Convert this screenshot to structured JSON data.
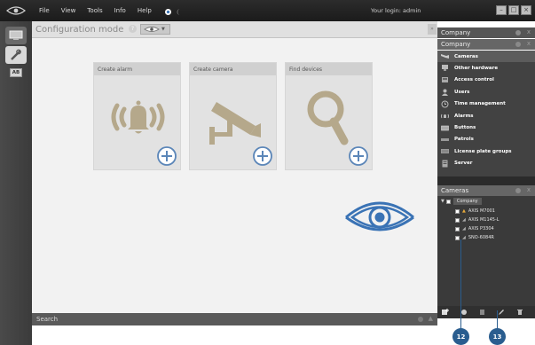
{
  "menubar": {
    "items": [
      "File",
      "View",
      "Tools",
      "Info",
      "Help"
    ],
    "login_text": "Your login: admin"
  },
  "left_rail": {
    "badge": "AB"
  },
  "main": {
    "title": "Configuration mode",
    "cards": [
      {
        "title": "Create alarm",
        "icon": "alarm-bell-icon"
      },
      {
        "title": "Create camera",
        "icon": "camera-icon"
      },
      {
        "title": "Find devices",
        "icon": "magnifier-icon"
      }
    ],
    "search_label": "Search"
  },
  "company_panel": {
    "title_1": "Company",
    "title_2": "Company",
    "items": [
      "Cameras",
      "Other hardware",
      "Access control",
      "Users",
      "Time management",
      "Alarms",
      "Buttons",
      "Patrols",
      "License plate groups",
      "Server"
    ],
    "active_index": 0
  },
  "cameras_panel": {
    "title": "Cameras",
    "root": "Company",
    "cameras": [
      "AXIS M7001",
      "AXIS M1145-L",
      "AXIS P3304",
      "SNO-6084R"
    ]
  },
  "callouts": [
    "12",
    "13"
  ],
  "colors": {
    "accent": "#2a5d8f",
    "icon_tan": "#b5a88b",
    "eye_blue": "#3a73b5"
  }
}
